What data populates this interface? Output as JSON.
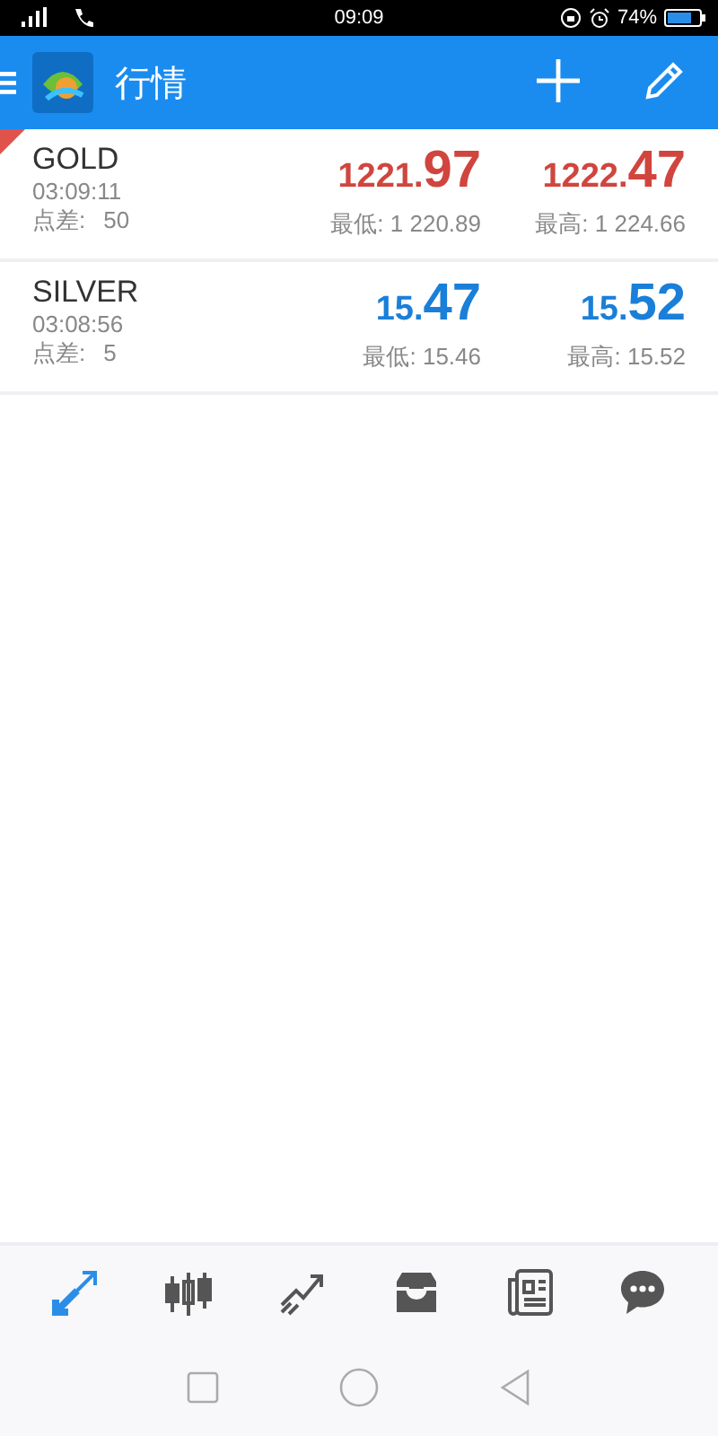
{
  "status_bar": {
    "time": "09:09",
    "battery": "74%"
  },
  "header": {
    "title": "行情"
  },
  "quotes": [
    {
      "symbol": "GOLD",
      "time": "03:09:11",
      "spread_label": "点差:",
      "spread": "50",
      "flagged": true,
      "color": "#d0453e",
      "bid": {
        "head": "1221.",
        "tail": "97"
      },
      "ask": {
        "head": "1222.",
        "tail": "47"
      },
      "low": "最低: 1 220.89",
      "high": "最高: 1 224.66"
    },
    {
      "symbol": "SILVER",
      "time": "03:08:56",
      "spread_label": "点差:",
      "spread": "5",
      "flagged": false,
      "color": "#1a7fd8",
      "bid": {
        "head": "15.",
        "tail": "47"
      },
      "ask": {
        "head": "15.",
        "tail": "52"
      },
      "low": "最低: 15.46",
      "high": "最高: 15.52"
    }
  ],
  "bottom_nav": [
    {
      "kind": "quotes",
      "selected": true
    },
    {
      "kind": "chart",
      "selected": false
    },
    {
      "kind": "trade",
      "selected": false
    },
    {
      "kind": "history",
      "selected": false
    },
    {
      "kind": "news",
      "selected": false
    },
    {
      "kind": "chat",
      "selected": false
    }
  ]
}
